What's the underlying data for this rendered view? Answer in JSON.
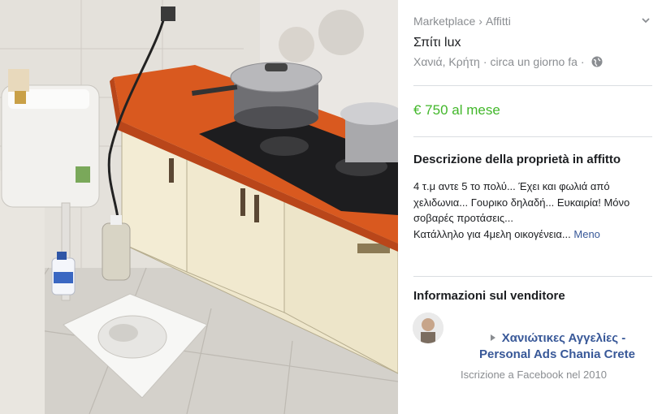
{
  "breadcrumb": {
    "root": "Marketplace",
    "separator": "›",
    "section": "Affitti"
  },
  "listing": {
    "title": "Σπίτι lux",
    "location": "Χανιά, Κρήτη",
    "posted": "circa un giorno fa",
    "separator": "·",
    "price": "€ 750 al mese"
  },
  "description": {
    "heading": "Descrizione della proprietà in affitto",
    "line1": "4 τ.μ αντε 5 το πολύ... Έχει και φωλιά από χελιδωνια... Γουρικο δηλαδή... Ευκαιρία! Μόνο σοβαρές προτάσεις...",
    "line2": "Κατάλληλο για 4μελη οικογένεια...",
    "more_label": "Meno"
  },
  "seller": {
    "heading": "Informazioni sul venditore",
    "name_line1": "Χανιώτικες Αγγελίες -",
    "name_line2": "Personal Ads Chania Crete",
    "joined": "Iscrizione a Facebook nel 2010"
  },
  "colors": {
    "price": "#42b72a",
    "link": "#385898",
    "muted": "#8a8d91",
    "countertop": "#d9591f"
  },
  "icons": {
    "dropdown": "chevron-down-icon",
    "privacy": "globe-icon",
    "name_marker": "triangle-right-icon"
  }
}
